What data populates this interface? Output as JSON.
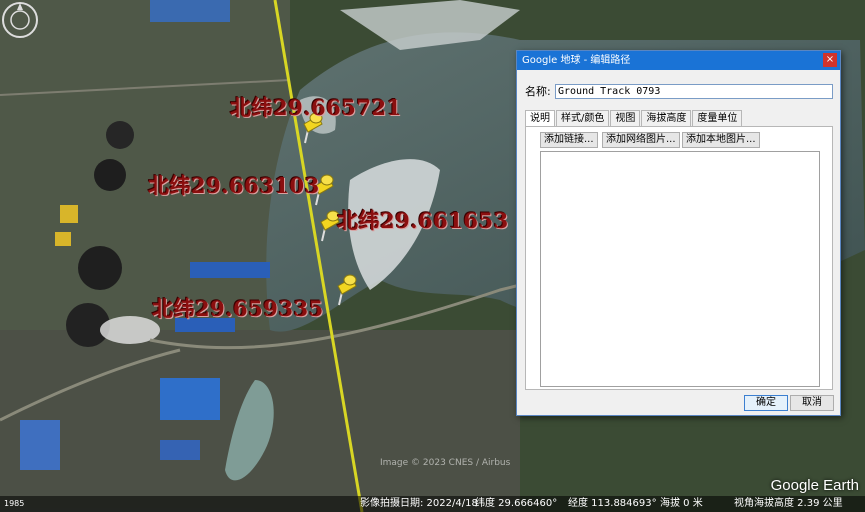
{
  "map": {
    "pins": [
      {
        "label": "北纬29.665721"
      },
      {
        "label": "北纬29.663103"
      },
      {
        "label": "北纬29.661653"
      },
      {
        "label": "北纬29.659335"
      }
    ],
    "track_color": "#d8d624",
    "pin_color": "#f2d520",
    "copyright": "Image © 2023 CNES / Airbus",
    "logo": "Google Earth",
    "year_badge": "1985"
  },
  "status_bar": {
    "capture_date": "影像拍摄日期: 2022/4/18",
    "lat": "纬度  29.666460°",
    "lon": "经度  113.884693°",
    "elevation": "海拔       0 米",
    "eye_alt": "视角海拔高度  2.39 公里"
  },
  "dialog": {
    "title": "Google 地球 - 编辑路径",
    "close": "×",
    "name_label": "名称:",
    "name_value": "Ground Track 0793",
    "tabs": [
      "说明",
      "样式/颜色",
      "视图",
      "海拔高度",
      "度量单位"
    ],
    "buttons": {
      "add_link": "添加链接...",
      "add_web_image": "添加网络图片...",
      "add_local_image": "添加本地图片..."
    },
    "ok": "确定",
    "cancel": "取消"
  }
}
